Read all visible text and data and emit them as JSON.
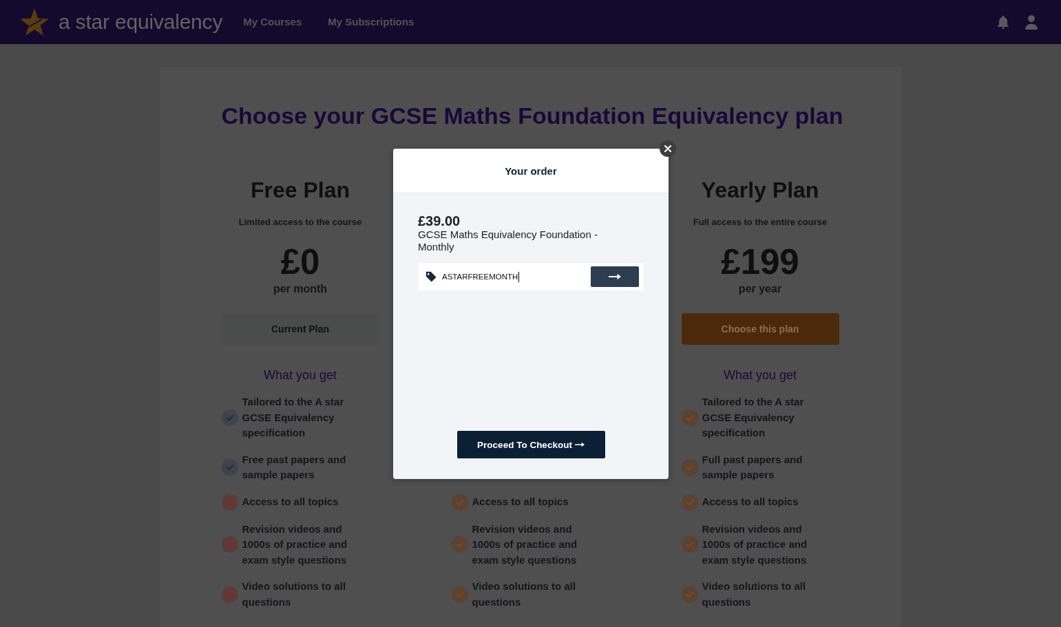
{
  "header": {
    "logo_text": "a star equivalency",
    "nav": [
      {
        "label": "My Courses",
        "selected": false
      },
      {
        "label": "My Subscriptions",
        "selected": false
      }
    ]
  },
  "page_title": "Choose your GCSE Maths Foundation Equivalency plan",
  "plans": [
    {
      "kind": "free",
      "name": "Free Plan",
      "subtitle": "Limited access to the course",
      "price": "£0",
      "period": "per month",
      "button": {
        "label": "Current Plan",
        "kind": "current"
      },
      "features_heading": "What you get",
      "features": [
        {
          "text": "Tailored to the A star GCSE Equivalency specification",
          "included": true
        },
        {
          "text": "Free past papers and sample papers",
          "included": true
        },
        {
          "text": "Access to all topics",
          "included": false
        },
        {
          "text": "Revision videos and 1000s of practice and exam style questions",
          "included": false
        },
        {
          "text": "Video solutions to all questions",
          "included": false
        }
      ]
    },
    {
      "kind": "paid",
      "features": [
        {
          "text": "Access to all topics",
          "included": true
        },
        {
          "text": "Revision videos and 1000s of practice and exam style questions",
          "included": true
        },
        {
          "text": "Video solutions to all questions",
          "included": true
        }
      ]
    },
    {
      "kind": "paid",
      "name": "Yearly Plan",
      "subtitle": "Full access to the entire course",
      "price": "£199",
      "period": "per year",
      "button": {
        "label": "Choose this plan",
        "kind": "choose"
      },
      "features_heading": "What you get",
      "features": [
        {
          "text": "Tailored to the A star GCSE Equivalency specification",
          "included": true
        },
        {
          "text": "Full past papers and sample papers",
          "included": true
        },
        {
          "text": "Access to all topics",
          "included": true
        },
        {
          "text": "Revision videos and 1000s of practice and exam style questions",
          "included": true
        },
        {
          "text": "Video solutions to all questions",
          "included": true
        }
      ]
    }
  ],
  "order_modal": {
    "title": "Your order",
    "price": "£39.00",
    "product": "GCSE Maths Equivalency Foundation - Monthly",
    "coupon": {
      "value": "ASTARFREEMONTH"
    },
    "checkout_button": "Proceed To Checkout"
  }
}
